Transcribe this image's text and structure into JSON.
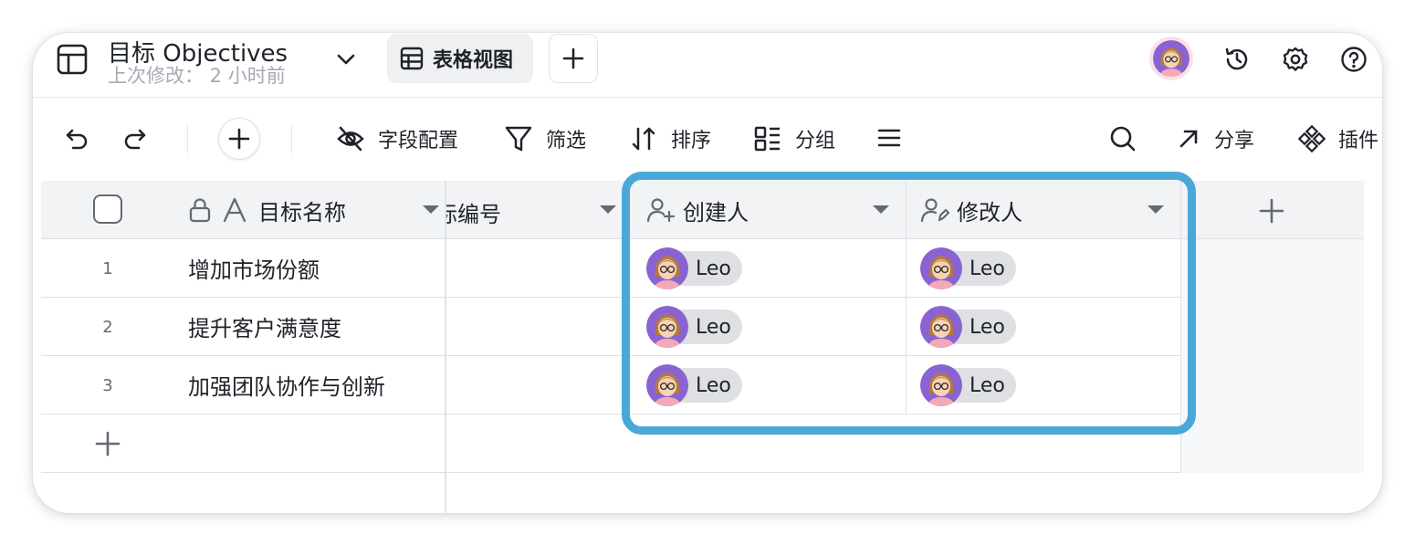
{
  "header": {
    "title": "目标 Objectives",
    "subtitle": "上次修改： 2 小时前",
    "view_tab_label": "表格视图"
  },
  "toolbar": {
    "field_config": "字段配置",
    "filter": "筛选",
    "sort": "排序",
    "group": "分组",
    "share": "分享",
    "plugins": "插件"
  },
  "table": {
    "columns": {
      "name": "目标名称",
      "number": "标编号",
      "creator": "创建人",
      "modifier": "修改人"
    },
    "rows": [
      {
        "num": "1",
        "name": "增加市场份额",
        "creator": "Leo",
        "modifier": "Leo"
      },
      {
        "num": "2",
        "name": "提升客户满意度",
        "creator": "Leo",
        "modifier": "Leo"
      },
      {
        "num": "3",
        "name": "加强团队协作与创新",
        "creator": "Leo",
        "modifier": "Leo"
      }
    ]
  },
  "colors": {
    "highlight_border": "#4aa8d8",
    "header_bg": "#f2f3f5",
    "chip_bg": "#dee0e3",
    "avatar_bg": "#8a63d2"
  },
  "icons": [
    "table-icon",
    "chevron-down-icon",
    "grid-view-icon",
    "plus-icon",
    "history-icon",
    "gear-icon",
    "help-icon",
    "undo-icon",
    "redo-icon",
    "eye-off-icon",
    "filter-icon",
    "sort-icon",
    "group-icon",
    "menu-icon",
    "search-icon",
    "arrow-up-right-icon",
    "plugin-icon",
    "lock-icon",
    "text-field-icon",
    "user-add-icon",
    "user-edit-icon"
  ]
}
